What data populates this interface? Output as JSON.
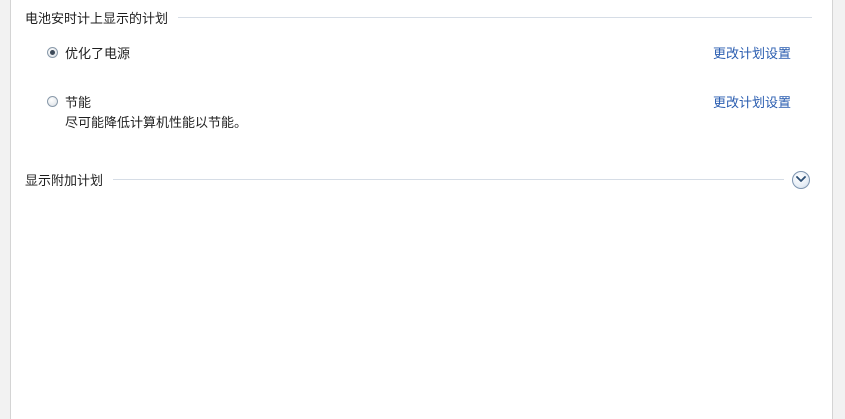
{
  "plans_section": {
    "title": "电池安时计上显示的计划",
    "plans": [
      {
        "name": "优化了电源",
        "selected": true,
        "link": "更改计划设置",
        "description": ""
      },
      {
        "name": "节能",
        "selected": false,
        "link": "更改计划设置",
        "description": "尽可能降低计算机性能以节能。"
      }
    ]
  },
  "additional_section": {
    "title": "显示附加计划",
    "expand_icon": "chevron-down-icon"
  },
  "colors": {
    "link": "#2a5db0",
    "rule": "#d6dde6"
  }
}
